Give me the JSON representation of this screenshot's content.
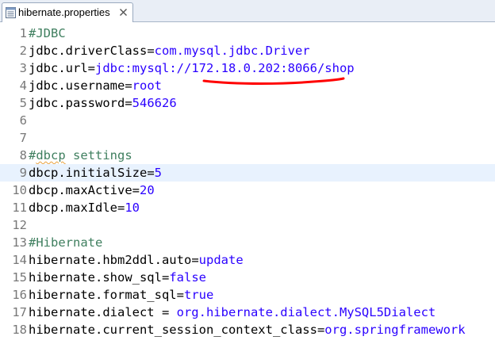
{
  "tab": {
    "label": "hibernate.properties",
    "close_glyph": "✕"
  },
  "editor": {
    "current_line": 9,
    "lines": [
      {
        "num": "1",
        "parts": [
          {
            "t": "#JDBC",
            "c": "c"
          }
        ]
      },
      {
        "num": "2",
        "parts": [
          {
            "t": "jdbc.driverClass",
            "c": "k"
          },
          {
            "t": "=",
            "c": "k"
          },
          {
            "t": "com.mysql.jdbc.Driver",
            "c": "v"
          }
        ]
      },
      {
        "num": "3",
        "parts": [
          {
            "t": "jdbc.url",
            "c": "k"
          },
          {
            "t": "=",
            "c": "k"
          },
          {
            "t": "jdbc:mysql://172.18.0.202:8066/shop",
            "c": "v"
          }
        ]
      },
      {
        "num": "4",
        "parts": [
          {
            "t": "jdbc.username",
            "c": "k"
          },
          {
            "t": "=",
            "c": "k"
          },
          {
            "t": "root",
            "c": "v"
          }
        ]
      },
      {
        "num": "5",
        "parts": [
          {
            "t": "jdbc.password",
            "c": "k"
          },
          {
            "t": "=",
            "c": "k"
          },
          {
            "t": "546626",
            "c": "v"
          }
        ]
      },
      {
        "num": "6",
        "parts": []
      },
      {
        "num": "7",
        "parts": []
      },
      {
        "num": "8",
        "parts": [
          {
            "t": "#",
            "c": "c"
          },
          {
            "t": "dbcp",
            "c": "c squiggle"
          },
          {
            "t": " settings",
            "c": "c"
          }
        ]
      },
      {
        "num": "9",
        "parts": [
          {
            "t": "dbcp.initialSize",
            "c": "k"
          },
          {
            "t": "=",
            "c": "k"
          },
          {
            "t": "5",
            "c": "v"
          }
        ]
      },
      {
        "num": "10",
        "parts": [
          {
            "t": "dbcp.maxActive",
            "c": "k"
          },
          {
            "t": "=",
            "c": "k"
          },
          {
            "t": "20",
            "c": "v"
          }
        ]
      },
      {
        "num": "11",
        "parts": [
          {
            "t": "dbcp.maxIdle",
            "c": "k"
          },
          {
            "t": "=",
            "c": "k"
          },
          {
            "t": "10",
            "c": "v"
          }
        ]
      },
      {
        "num": "12",
        "parts": []
      },
      {
        "num": "13",
        "parts": [
          {
            "t": "#Hibernate",
            "c": "c"
          }
        ]
      },
      {
        "num": "14",
        "parts": [
          {
            "t": "hibernate.hbm2ddl.auto",
            "c": "k"
          },
          {
            "t": "=",
            "c": "k"
          },
          {
            "t": "update",
            "c": "v"
          }
        ]
      },
      {
        "num": "15",
        "parts": [
          {
            "t": "hibernate.show_sql",
            "c": "k"
          },
          {
            "t": "=",
            "c": "k"
          },
          {
            "t": "false",
            "c": "v"
          }
        ]
      },
      {
        "num": "16",
        "parts": [
          {
            "t": "hibernate.format_sql",
            "c": "k"
          },
          {
            "t": "=",
            "c": "k"
          },
          {
            "t": "true",
            "c": "v"
          }
        ]
      },
      {
        "num": "17",
        "parts": [
          {
            "t": "hibernate.dialect",
            "c": "k"
          },
          {
            "t": " = ",
            "c": "k"
          },
          {
            "t": "org.hibernate.dialect.MySQL5Dialect",
            "c": "v"
          }
        ]
      },
      {
        "num": "18",
        "parts": [
          {
            "t": "hibernate.current_session_context_class",
            "c": "k"
          },
          {
            "t": "=",
            "c": "k"
          },
          {
            "t": "org.springframework",
            "c": "v"
          }
        ]
      }
    ]
  },
  "colors": {
    "key": "#000000",
    "value": "#2a00ff",
    "comment": "#3f7f5f",
    "line_number": "#787878",
    "current_line_bg": "#e8f2fe",
    "annotation": "#ff0000"
  },
  "icons": {
    "tab_icon": "properties-file-icon",
    "tab_close": "close-icon"
  }
}
